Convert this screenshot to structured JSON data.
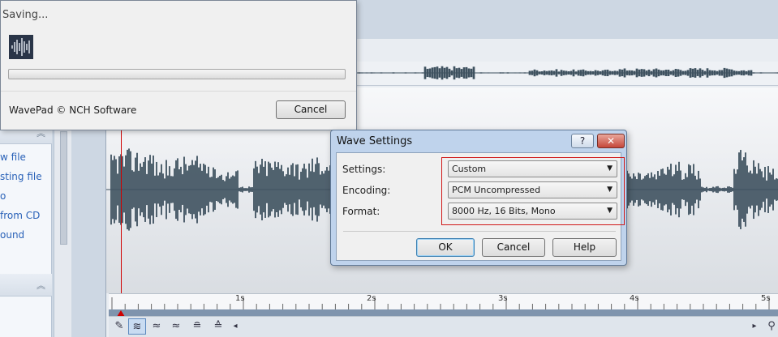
{
  "saving_dialog": {
    "title": "Saving...",
    "copyright": "WavePad © NCH Software",
    "cancel_label": "Cancel",
    "progress": 0
  },
  "wave_settings": {
    "title": "Wave Settings",
    "help_title_glyph": "?",
    "close_glyph": "✕",
    "settings_label": "Settings:",
    "settings_value": "Custom",
    "encoding_label": "Encoding:",
    "encoding_value": "PCM Uncompressed",
    "format_label": "Format:",
    "format_value": "8000 Hz, 16 Bits, Mono",
    "ok_label": "OK",
    "cancel_label": "Cancel",
    "help_label": "Help"
  },
  "left_panel": {
    "links": [
      "w file",
      "sting file",
      "o",
      "from CD",
      "ound"
    ]
  },
  "timeline": {
    "labels": [
      "1s",
      "2s",
      "3s",
      "4s",
      "5s"
    ]
  },
  "colors": {
    "highlight_red": "#d01818",
    "waveform": "#3f5260",
    "cursor": "#d00000"
  },
  "icons": [
    "wavepad-icon",
    "pencil-icon",
    "waveform-select-icon",
    "zoom-icon",
    "collapse-icon"
  ]
}
